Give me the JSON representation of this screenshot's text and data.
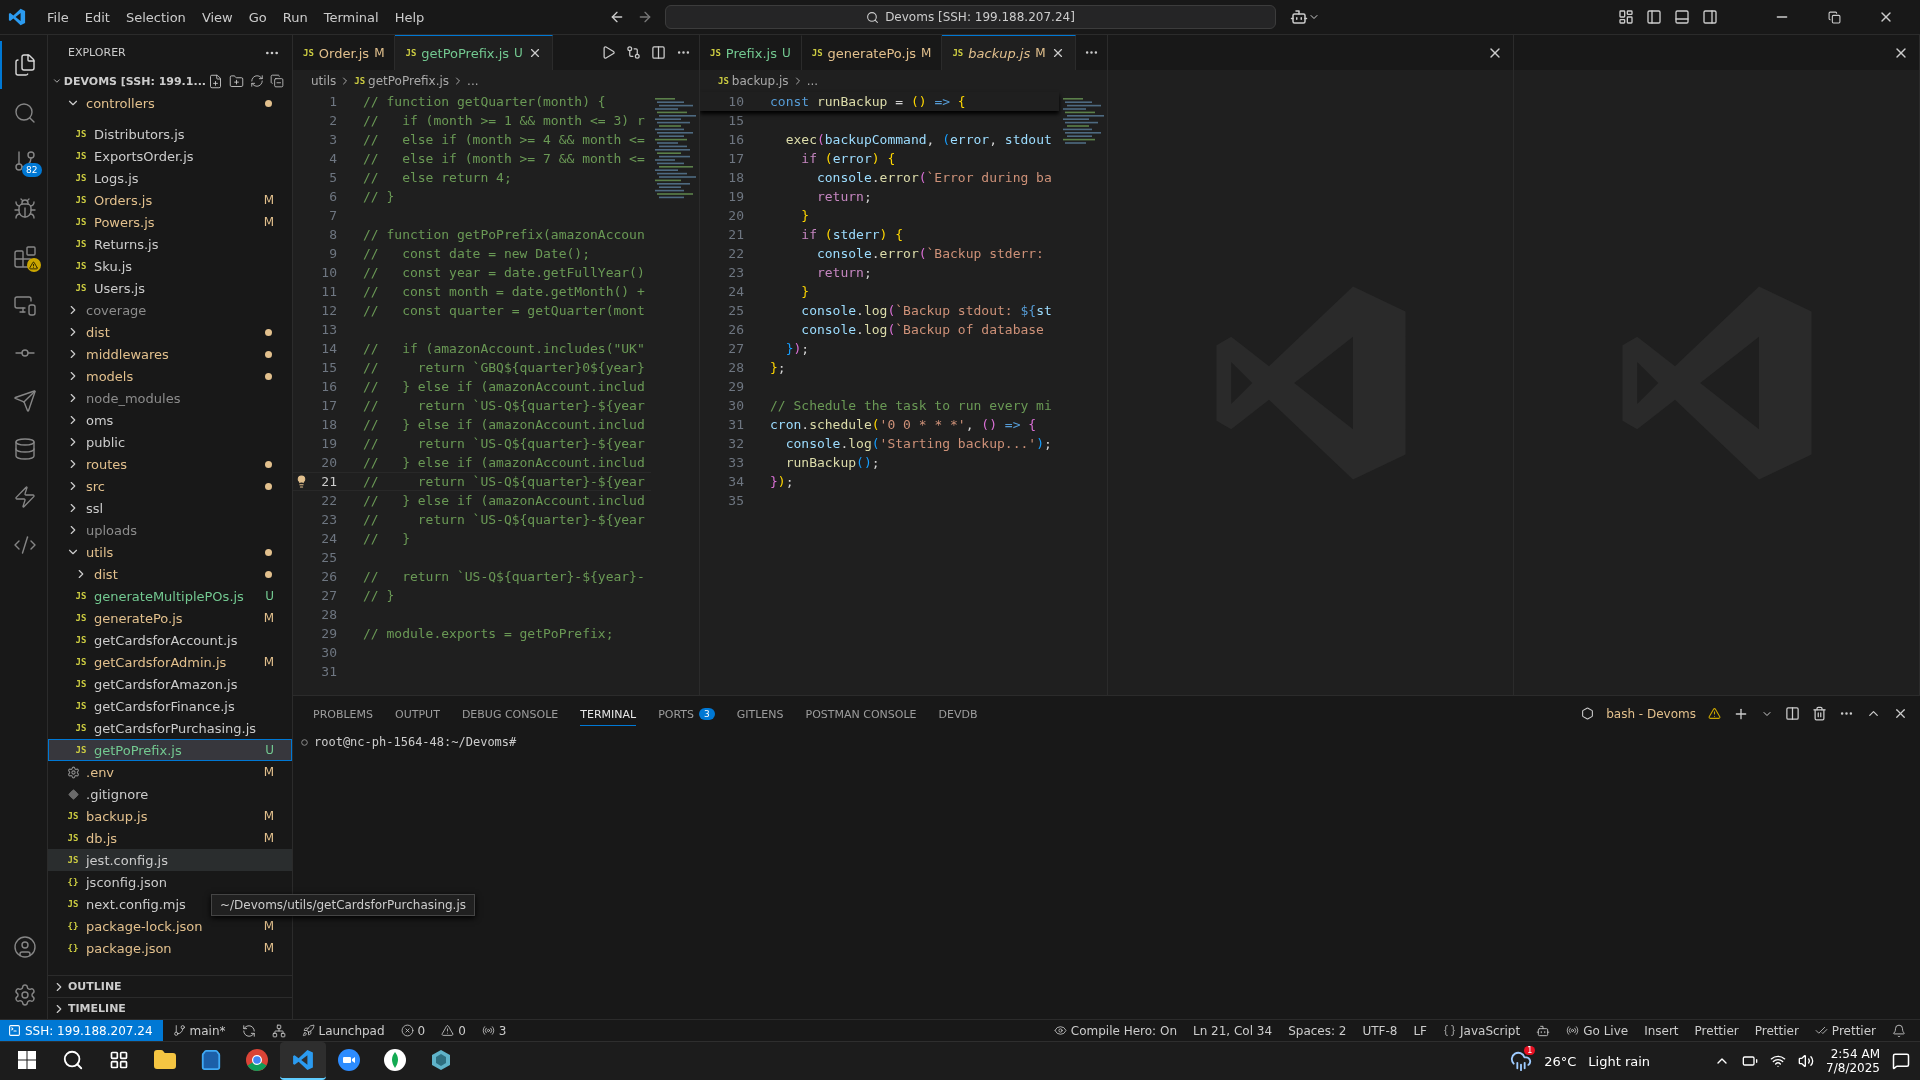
{
  "menu": [
    "File",
    "Edit",
    "Selection",
    "View",
    "Go",
    "Run",
    "Terminal",
    "Help"
  ],
  "command_center": "Devoms [SSH: 199.188.207.24]",
  "activity_bar": [
    {
      "kind": "explorer",
      "selected": true
    },
    {
      "kind": "search",
      "selected": false
    },
    {
      "kind": "scm",
      "selected": false,
      "badge": "82"
    },
    {
      "kind": "debug",
      "selected": false
    },
    {
      "kind": "extensions",
      "selected": false,
      "warning": true
    },
    {
      "kind": "remote",
      "selected": false
    },
    {
      "kind": "gitlens",
      "selected": false
    },
    {
      "kind": "postman",
      "selected": false
    },
    {
      "kind": "devdb",
      "selected": false
    },
    {
      "kind": "thunder",
      "selected": false
    },
    {
      "kind": "python",
      "selected": false
    }
  ],
  "sidebar": {
    "title": "EXPLORER",
    "root": "DEVOMS [SSH: 199.1...",
    "sections": [
      "OUTLINE",
      "TIMELINE"
    ],
    "tooltip": "~/Devoms/utils/getCardsforPurchasing.js",
    "items": [
      {
        "kind": "folder",
        "name": "controllers",
        "color": "#e2c08d",
        "dot": true,
        "expanded": true,
        "selected": false,
        "children": [
          {
            "kind": "file",
            "icon": "JS",
            "name": "Distributors.js",
            "color": "#cccccc",
            "selected": false,
            "hovered": false
          },
          {
            "kind": "file",
            "icon": "JS",
            "name": "ExportsOrder.js",
            "color": "#cccccc",
            "selected": false,
            "hovered": false
          },
          {
            "kind": "file",
            "icon": "JS",
            "name": "Logs.js",
            "color": "#cccccc",
            "selected": false,
            "hovered": false
          },
          {
            "kind": "file",
            "icon": "JS",
            "name": "Orders.js",
            "color": "#e2c08d",
            "badge": "M",
            "selected": false,
            "hovered": false
          },
          {
            "kind": "file",
            "icon": "JS",
            "name": "Powers.js",
            "color": "#e2c08d",
            "badge": "M",
            "selected": false,
            "hovered": false
          },
          {
            "kind": "file",
            "icon": "JS",
            "name": "Returns.js",
            "color": "#cccccc",
            "selected": false,
            "hovered": false
          },
          {
            "kind": "file",
            "icon": "JS",
            "name": "Sku.js",
            "color": "#cccccc",
            "selected": false,
            "hovered": false
          },
          {
            "kind": "file",
            "icon": "JS",
            "name": "Users.js",
            "color": "#cccccc",
            "selected": false,
            "hovered": false
          }
        ]
      },
      {
        "kind": "folder",
        "name": "coverage",
        "color": "#8c8c8c",
        "dot": false,
        "expanded": false,
        "selected": false
      },
      {
        "kind": "folder",
        "name": "dist",
        "color": "#e2c08d",
        "dot": true,
        "expanded": false,
        "selected": false
      },
      {
        "kind": "folder",
        "name": "middlewares",
        "color": "#e2c08d",
        "dot": true,
        "expanded": false,
        "selected": false
      },
      {
        "kind": "folder",
        "name": "models",
        "color": "#e2c08d",
        "dot": true,
        "expanded": false,
        "selected": false
      },
      {
        "kind": "folder",
        "name": "node_modules",
        "color": "#8c8c8c",
        "dot": false,
        "expanded": false,
        "selected": false
      },
      {
        "kind": "folder",
        "name": "oms",
        "color": "#cccccc",
        "dot": false,
        "expanded": false,
        "selected": false
      },
      {
        "kind": "folder",
        "name": "public",
        "color": "#cccccc",
        "dot": false,
        "expanded": false,
        "selected": false
      },
      {
        "kind": "folder",
        "name": "routes",
        "color": "#e2c08d",
        "dot": true,
        "expanded": false,
        "selected": false
      },
      {
        "kind": "folder",
        "name": "src",
        "color": "#e2c08d",
        "dot": true,
        "expanded": false,
        "selected": false
      },
      {
        "kind": "folder",
        "name": "ssl",
        "color": "#cccccc",
        "dot": false,
        "expanded": false,
        "selected": false
      },
      {
        "kind": "folder",
        "name": "uploads",
        "color": "#8c8c8c",
        "dot": false,
        "expanded": false,
        "selected": false
      },
      {
        "kind": "folder",
        "name": "utils",
        "color": "#e2c08d",
        "dot": true,
        "expanded": true,
        "selected": false,
        "children": [
          {
            "kind": "folder",
            "name": "dist",
            "color": "#e2c08d",
            "dot": true,
            "expanded": false,
            "selected": false
          },
          {
            "kind": "file",
            "icon": "JS",
            "name": "generateMultiplePOs.js",
            "color": "#73c991",
            "badge": "U",
            "selected": false,
            "hovered": false
          },
          {
            "kind": "file",
            "icon": "JS",
            "name": "generatePo.js",
            "color": "#e2c08d",
            "badge": "M",
            "selected": false,
            "hovered": false
          },
          {
            "kind": "file",
            "icon": "JS",
            "name": "getCardsforAccount.js",
            "color": "#cccccc",
            "selected": false,
            "hovered": false
          },
          {
            "kind": "file",
            "icon": "JS",
            "name": "getCardsforAdmin.js",
            "color": "#e2c08d",
            "badge": "M",
            "selected": false,
            "hovered": false
          },
          {
            "kind": "file",
            "icon": "JS",
            "name": "getCardsforAmazon.js",
            "color": "#cccccc",
            "selected": false,
            "hovered": false
          },
          {
            "kind": "file",
            "icon": "JS",
            "name": "getCardsforFinance.js",
            "color": "#cccccc",
            "selected": false,
            "hovered": false
          },
          {
            "kind": "file",
            "icon": "JS",
            "name": "getCardsforPurchasing.js",
            "color": "#cccccc",
            "selected": false,
            "hovered": false
          },
          {
            "kind": "file",
            "icon": "JS",
            "name": "getPoPrefix.js",
            "color": "#73c991",
            "badge": "U",
            "selected": true,
            "hovered": false
          }
        ]
      },
      {
        "kind": "env",
        "name": ".env",
        "color": "#e2c08d",
        "badge": "M",
        "selected": false,
        "hovered": false
      },
      {
        "kind": "git",
        "name": ".gitignore",
        "color": "#cccccc",
        "selected": false,
        "hovered": false
      },
      {
        "kind": "file",
        "icon": "JS",
        "name": "backup.js",
        "color": "#e2c08d",
        "badge": "M",
        "selected": false,
        "hovered": false
      },
      {
        "kind": "file",
        "icon": "JS",
        "name": "db.js",
        "color": "#e2c08d",
        "badge": "M",
        "selected": false,
        "hovered": false
      },
      {
        "kind": "file",
        "icon": "JS",
        "name": "jest.config.js",
        "color": "#cccccc",
        "selected": false,
        "hovered": true
      },
      {
        "kind": "file",
        "icon": "{}",
        "name": "jsconfig.json",
        "color": "#cccccc",
        "selected": false,
        "hovered": false
      },
      {
        "kind": "file",
        "icon": "JS",
        "name": "next.config.mjs",
        "color": "#cccccc",
        "selected": false,
        "hovered": false
      },
      {
        "kind": "file",
        "icon": "{}",
        "name": "package-lock.json",
        "color": "#e2c08d",
        "badge": "M",
        "selected": false,
        "hovered": false
      },
      {
        "kind": "file",
        "icon": "{}",
        "name": "package.json",
        "color": "#e2c08d",
        "badge": "M",
        "selected": false,
        "hovered": false
      }
    ]
  },
  "editor_left": {
    "tabs": [
      {
        "icon": "JS",
        "label": "Order.js",
        "badge": "M",
        "color": "#e2c08d",
        "preview": false,
        "selected": false
      },
      {
        "icon": "JS",
        "label": "getPoPrefix.js",
        "badge": "U",
        "color": "#73c991",
        "preview": false,
        "selected": true
      }
    ],
    "breadcrumb": [
      {
        "text": "utils"
      },
      {
        "icon": "JS",
        "text": "getPoPrefix.js"
      },
      {
        "text": "..."
      }
    ],
    "lines": [
      {
        "number": "1",
        "code": "// function getQuarter(month) {",
        "current": false
      },
      {
        "number": "2",
        "code": "//   if (month >= 1 && month <= 3) r",
        "current": false
      },
      {
        "number": "3",
        "code": "//   else if (month >= 4 && month <=",
        "current": false
      },
      {
        "number": "4",
        "code": "//   else if (month >= 7 && month <=",
        "current": false
      },
      {
        "number": "5",
        "code": "//   else return 4;",
        "current": false
      },
      {
        "number": "6",
        "code": "// }",
        "current": false
      },
      {
        "number": "7",
        "current": false
      },
      {
        "number": "8",
        "code": "// function getPoPrefix(amazonAccoun",
        "current": false
      },
      {
        "number": "9",
        "code": "//   const date = new Date();",
        "current": false
      },
      {
        "number": "10",
        "code": "//   const year = date.getFullYear()",
        "current": false
      },
      {
        "number": "11",
        "code": "//   const month = date.getMonth() +",
        "current": false
      },
      {
        "number": "12",
        "code": "//   const quarter = getQuarter(mont",
        "current": false
      },
      {
        "number": "13",
        "current": false
      },
      {
        "number": "14",
        "code": "//   if (amazonAccount.includes(\"UK\"",
        "current": false
      },
      {
        "number": "15",
        "code": "//     return `GBQ${quarter}0${year}",
        "current": false
      },
      {
        "number": "16",
        "code": "//   } else if (amazonAccount.includ",
        "current": false
      },
      {
        "number": "17",
        "code": "//     return `US-Q${quarter}-${year",
        "current": false
      },
      {
        "number": "18",
        "code": "//   } else if (amazonAccount.includ",
        "current": false
      },
      {
        "number": "19",
        "code": "//     return `US-Q${quarter}-${year",
        "current": false
      },
      {
        "number": "20",
        "code": "//   } else if (amazonAccount.includ",
        "current": false
      },
      {
        "number": "21",
        "code": "//     return `US-Q${quarter}-${year",
        "current": true
      },
      {
        "number": "22",
        "code": "//   } else if (amazonAccount.includ",
        "current": false
      },
      {
        "number": "23",
        "code": "//     return `US-Q${quarter}-${year",
        "current": false
      },
      {
        "number": "24",
        "code": "//   }",
        "current": false
      },
      {
        "number": "25",
        "current": false
      },
      {
        "number": "26",
        "code": "//   return `US-Q${quarter}-${year}-",
        "current": false
      },
      {
        "number": "27",
        "code": "// }",
        "current": false
      },
      {
        "number": "28",
        "current": false
      },
      {
        "number": "29",
        "code": "// module.exports = getPoPrefix;",
        "current": false
      },
      {
        "number": "30",
        "current": false
      },
      {
        "number": "31",
        "current": false
      }
    ]
  },
  "editor_right": {
    "tabs": [
      {
        "icon": "JS",
        "label": "Prefix.js",
        "badge": "U",
        "color": "#73c991",
        "preview": false,
        "selected": false
      },
      {
        "icon": "JS",
        "label": "generatePo.js",
        "badge": "M",
        "color": "#e2c08d",
        "preview": false,
        "selected": false
      },
      {
        "icon": "JS",
        "label": "backup.js",
        "badge": "M",
        "color": "#e2c08d",
        "preview": true,
        "selected": true
      }
    ],
    "breadcrumb": [
      {
        "icon": "JS",
        "text": "backup.js"
      },
      {
        "text": "..."
      }
    ],
    "sticky": {
      "number": "10",
      "tokens": [
        {
          "text": "const",
          "kind": "kw"
        },
        {
          "text": " runBackup",
          "kind": "fn"
        },
        {
          "text": " =",
          "kind": "p"
        },
        {
          "text": " ()",
          "kind": "b1"
        },
        {
          "text": " =>",
          "kind": "kw"
        },
        {
          "text": " {",
          "kind": "b1"
        }
      ]
    },
    "lines": [
      {
        "number": "15"
      },
      {
        "number": "16",
        "tokens": [
          {
            "text": "  exec",
            "kind": "fn"
          },
          {
            "text": "(",
            "kind": "b2"
          },
          {
            "text": "backupCommand",
            "kind": "var"
          },
          {
            "text": ",",
            "kind": "p"
          },
          {
            "text": " (",
            "kind": "b3"
          },
          {
            "text": "error",
            "kind": "var"
          },
          {
            "text": ",",
            "kind": "p"
          },
          {
            "text": " stdout",
            "kind": "var"
          }
        ]
      },
      {
        "number": "17",
        "tokens": [
          {
            "text": "    if",
            "kind": "ctl"
          },
          {
            "text": " (",
            "kind": "b1"
          },
          {
            "text": "error",
            "kind": "var"
          },
          {
            "text": ") {",
            "kind": "b1"
          }
        ]
      },
      {
        "number": "18",
        "tokens": [
          {
            "text": "      console",
            "kind": "var"
          },
          {
            "text": ".",
            "kind": "p"
          },
          {
            "text": "error",
            "kind": "fn"
          },
          {
            "text": "(",
            "kind": "b2"
          },
          {
            "text": "`Error during ba",
            "kind": "str"
          }
        ]
      },
      {
        "number": "19",
        "tokens": [
          {
            "text": "      return",
            "kind": "ctl"
          },
          {
            "text": ";",
            "kind": "p"
          }
        ]
      },
      {
        "number": "20",
        "tokens": [
          {
            "text": "    }",
            "kind": "b1"
          }
        ]
      },
      {
        "number": "21",
        "tokens": [
          {
            "text": "    if",
            "kind": "ctl"
          },
          {
            "text": " (",
            "kind": "b1"
          },
          {
            "text": "stderr",
            "kind": "var"
          },
          {
            "text": ") {",
            "kind": "b1"
          }
        ]
      },
      {
        "number": "22",
        "tokens": [
          {
            "text": "      console",
            "kind": "var"
          },
          {
            "text": ".",
            "kind": "p"
          },
          {
            "text": "error",
            "kind": "fn"
          },
          {
            "text": "(",
            "kind": "b2"
          },
          {
            "text": "`Backup stderr:",
            "kind": "str"
          }
        ]
      },
      {
        "number": "23",
        "tokens": [
          {
            "text": "      return",
            "kind": "ctl"
          },
          {
            "text": ";",
            "kind": "p"
          }
        ]
      },
      {
        "number": "24",
        "tokens": [
          {
            "text": "    }",
            "kind": "b1"
          }
        ]
      },
      {
        "number": "25",
        "tokens": [
          {
            "text": "    console",
            "kind": "var"
          },
          {
            "text": ".",
            "kind": "p"
          },
          {
            "text": "log",
            "kind": "fn"
          },
          {
            "text": "(",
            "kind": "b2"
          },
          {
            "text": "`Backup stdout: ",
            "kind": "str"
          },
          {
            "text": "${",
            "kind": "kw"
          },
          {
            "text": "st",
            "kind": "var"
          }
        ]
      },
      {
        "number": "26",
        "tokens": [
          {
            "text": "    console",
            "kind": "var"
          },
          {
            "text": ".",
            "kind": "p"
          },
          {
            "text": "log",
            "kind": "fn"
          },
          {
            "text": "(",
            "kind": "b2"
          },
          {
            "text": "`Backup of database",
            "kind": "str"
          }
        ]
      },
      {
        "number": "27",
        "tokens": [
          {
            "text": "  }",
            "kind": "b3"
          },
          {
            "text": ")",
            "kind": "b2"
          },
          {
            "text": ";",
            "kind": "p"
          }
        ]
      },
      {
        "number": "28",
        "tokens": [
          {
            "text": "}",
            "kind": "b1"
          },
          {
            "text": ";",
            "kind": "p"
          }
        ]
      },
      {
        "number": "29"
      },
      {
        "number": "30",
        "tokens": [
          {
            "text": "// Schedule the task to run every mi",
            "kind": "cmt"
          }
        ]
      },
      {
        "number": "31",
        "tokens": [
          {
            "text": "cron",
            "kind": "var"
          },
          {
            "text": ".",
            "kind": "p"
          },
          {
            "text": "schedule",
            "kind": "fn"
          },
          {
            "text": "(",
            "kind": "b1"
          },
          {
            "text": "'0 0 * * *'",
            "kind": "str"
          },
          {
            "text": ",",
            "kind": "p"
          },
          {
            "text": " ()",
            "kind": "b2"
          },
          {
            "text": " =>",
            "kind": "kw"
          },
          {
            "text": " {",
            "kind": "b2"
          }
        ]
      },
      {
        "number": "32",
        "tokens": [
          {
            "text": "  console",
            "kind": "var"
          },
          {
            "text": ".",
            "kind": "p"
          },
          {
            "text": "log",
            "kind": "fn"
          },
          {
            "text": "(",
            "kind": "b3"
          },
          {
            "text": "'Starting backup...'",
            "kind": "str"
          },
          {
            "text": ")",
            "kind": "b3"
          },
          {
            "text": ";",
            "kind": "p"
          }
        ]
      },
      {
        "number": "33",
        "tokens": [
          {
            "text": "  runBackup",
            "kind": "fn"
          },
          {
            "text": "()",
            "kind": "b3"
          },
          {
            "text": ";",
            "kind": "p"
          }
        ]
      },
      {
        "number": "34",
        "tokens": [
          {
            "text": "}",
            "kind": "b2"
          },
          {
            "text": ")",
            "kind": "b1"
          },
          {
            "text": ";",
            "kind": "p"
          }
        ]
      },
      {
        "number": "35"
      }
    ]
  },
  "panel": {
    "tabs": [
      {
        "label": "PROBLEMS",
        "selected": false
      },
      {
        "label": "OUTPUT",
        "selected": false
      },
      {
        "label": "DEBUG CONSOLE",
        "selected": false
      },
      {
        "label": "TERMINAL",
        "selected": true
      },
      {
        "label": "PORTS",
        "badge": "3",
        "selected": false
      },
      {
        "label": "GITLENS",
        "selected": false
      },
      {
        "label": "POSTMAN CONSOLE",
        "selected": false
      },
      {
        "label": "DEVDB",
        "selected": false
      }
    ],
    "terminal_name": "bash - Devoms",
    "prompt": "root@nc-ph-1564-48:~/Devoms#"
  },
  "status_bar": {
    "remote": "SSH: 199.188.207.24",
    "left": [
      {
        "kind": "branch",
        "text": "main*"
      },
      {
        "kind": "sync"
      },
      {
        "kind": "graph"
      },
      {
        "kind": "rocket",
        "text": "Launchpad"
      },
      {
        "kind": "error",
        "text": "0"
      },
      {
        "kind": "warning",
        "text": "0"
      },
      {
        "kind": "radio",
        "text": "3"
      }
    ],
    "right": [
      {
        "kind": "eye",
        "text": "Compile Hero: On"
      },
      {
        "kind": "plain",
        "text": "Ln 21, Col 34"
      },
      {
        "kind": "plain",
        "text": "Spaces: 2"
      },
      {
        "kind": "plain",
        "text": "UTF-8"
      },
      {
        "kind": "plain",
        "text": "LF"
      },
      {
        "kind": "braces",
        "text": "JavaScript"
      },
      {
        "kind": "bot"
      },
      {
        "kind": "radio",
        "text": "Go Live"
      },
      {
        "kind": "plain",
        "text": "Insert"
      },
      {
        "kind": "plain",
        "text": "Prettier"
      },
      {
        "kind": "plain",
        "text": "Prettier"
      },
      {
        "kind": "checks",
        "text": "Prettier"
      },
      {
        "kind": "bell"
      }
    ]
  },
  "taskbar": {
    "apps": [
      {
        "kind": "start",
        "selected": false
      },
      {
        "kind": "search",
        "selected": false
      },
      {
        "kind": "taskview",
        "selected": false
      },
      {
        "kind": "files",
        "selected": false
      },
      {
        "kind": "store",
        "selected": false
      },
      {
        "kind": "chrome",
        "selected": false
      },
      {
        "kind": "vscode",
        "selected": true
      },
      {
        "kind": "zoom",
        "selected": false
      },
      {
        "kind": "leaf",
        "selected": false
      },
      {
        "kind": "gem",
        "selected": false
      }
    ],
    "weather": {
      "badge": "1",
      "temperature": "26°C",
      "condition": "Light rain"
    },
    "time": "2:54 AM",
    "date": "7/8/2025"
  }
}
